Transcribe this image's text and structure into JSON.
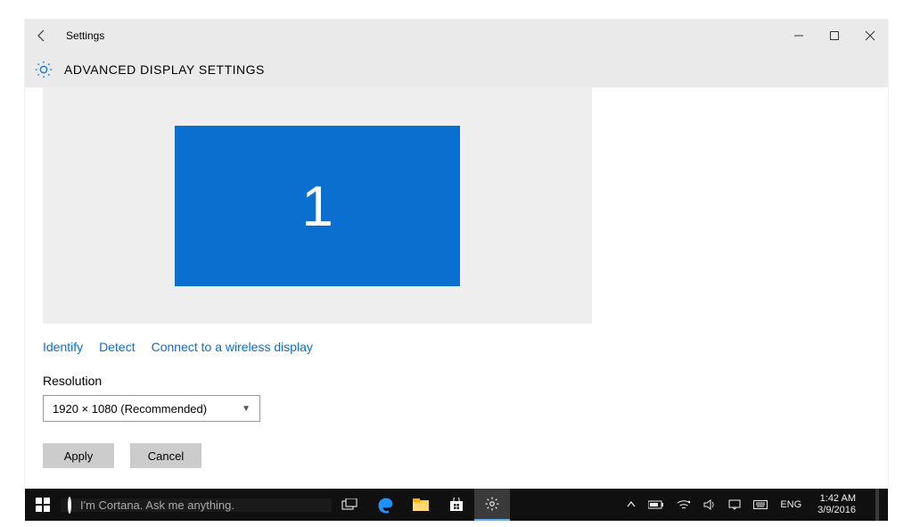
{
  "window": {
    "app_name": "Settings",
    "page_title": "ADVANCED DISPLAY SETTINGS"
  },
  "display": {
    "monitor_number": "1",
    "links": {
      "identify": "Identify",
      "detect": "Detect",
      "connect_wireless": "Connect to a wireless display"
    },
    "resolution_label": "Resolution",
    "resolution_value": "1920 × 1080 (Recommended)",
    "buttons": {
      "apply": "Apply",
      "cancel": "Cancel"
    }
  },
  "taskbar": {
    "cortana_placeholder": "I'm Cortana. Ask me anything.",
    "language": "ENG",
    "time": "1:42 AM",
    "date": "3/9/2016"
  }
}
